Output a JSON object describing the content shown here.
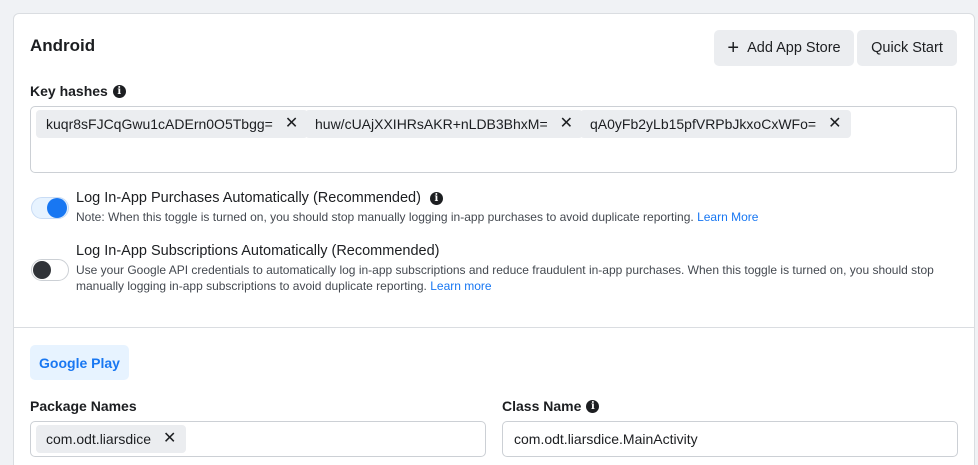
{
  "section": {
    "title": "Android"
  },
  "buttons": {
    "add_app_store": "Add App Store",
    "quick_start": "Quick Start"
  },
  "key_hashes": {
    "label": "Key hashes",
    "values": [
      "kuqr8sFJCqGwu1cADErn0O5Tbgg=",
      "huw/cUAjXXIHRsAKR+nLDB3BhxM=",
      "qA0yFb2yLb15pfVRPbJkxoCxWFo="
    ]
  },
  "purchases": {
    "title": "Log In-App Purchases Automatically (Recommended)",
    "enabled": true,
    "note": "Note: When this toggle is turned on, you should stop manually logging in-app purchases to avoid duplicate reporting.",
    "link": "Learn More"
  },
  "subscriptions": {
    "title": "Log In-App Subscriptions Automatically (Recommended)",
    "enabled": false,
    "note": "Use your Google API credentials to automatically log in-app subscriptions and reduce fraudulent in-app purchases. When this toggle is turned on, you should stop manually logging in-app subscriptions to avoid duplicate reporting.",
    "link": "Learn more"
  },
  "store_tab": "Google Play",
  "package_names": {
    "label": "Package Names",
    "values": [
      "com.odt.liarsdice"
    ]
  },
  "class_name": {
    "label": "Class Name",
    "value": "com.odt.liarsdice.MainActivity"
  },
  "colors": {
    "accent": "#1877f2",
    "tab_bg": "#e7f3ff",
    "button_bg": "#ebedf0"
  },
  "icons": {
    "info": "info-icon",
    "remove": "close-icon",
    "add": "plus-icon"
  }
}
